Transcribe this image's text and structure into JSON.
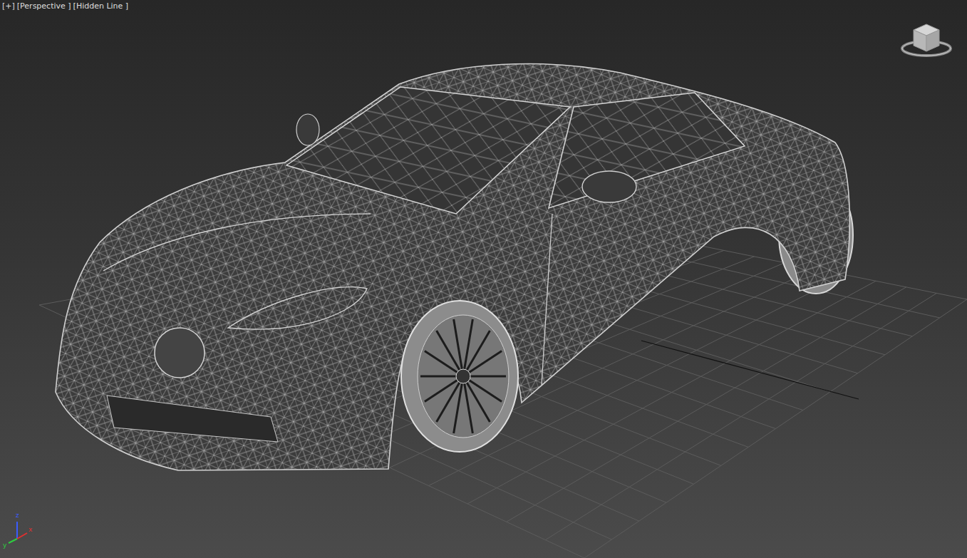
{
  "viewport": {
    "labels": [
      "[+]",
      "[Perspective ]",
      "[Hidden Line ]"
    ]
  },
  "axis_tripod": {
    "axes": [
      {
        "label": "z",
        "color": "#3a5cff"
      },
      {
        "label": "y",
        "color": "#2ecc40"
      },
      {
        "label": "x",
        "color": "#e03030"
      }
    ]
  }
}
